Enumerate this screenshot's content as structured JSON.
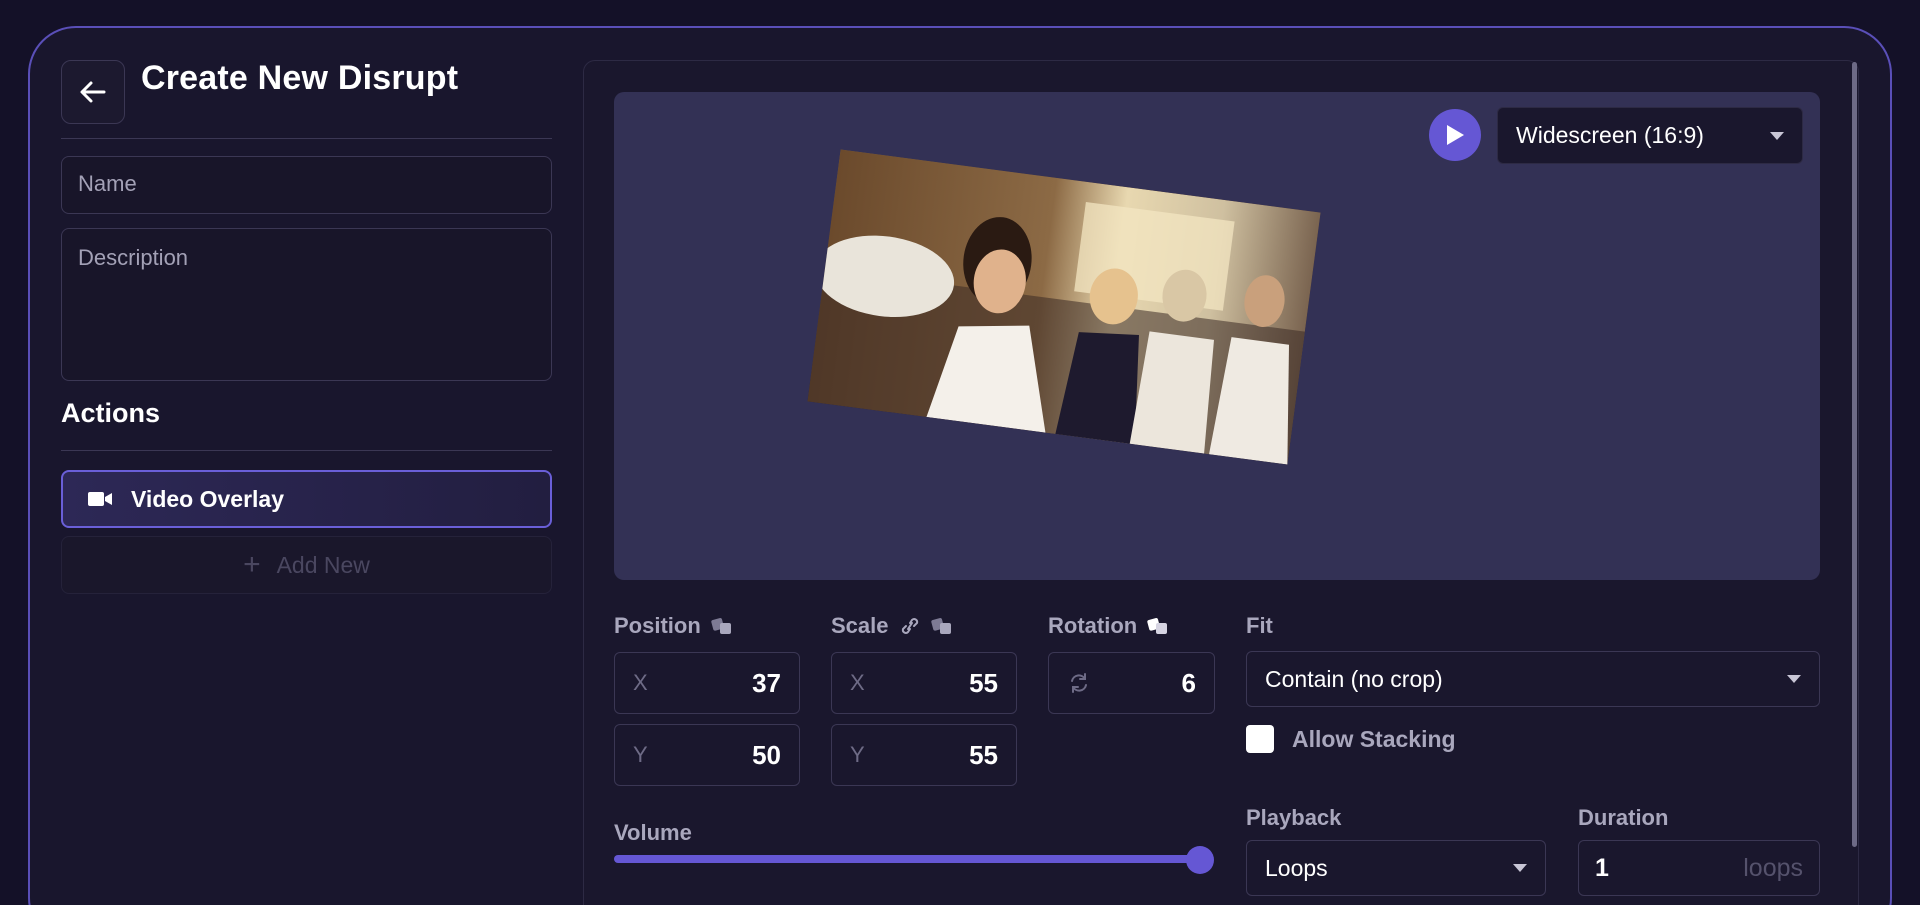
{
  "page": {
    "title": "Create New Disrupt"
  },
  "form": {
    "name_placeholder": "Name",
    "description_placeholder": "Description"
  },
  "actions": {
    "heading": "Actions",
    "items": [
      {
        "label": "Video Overlay",
        "icon": "video-camera-icon",
        "selected": true
      }
    ],
    "add_new_label": "Add New"
  },
  "preview": {
    "aspect_ratio": "Widescreen (16:9)",
    "play_icon": "play-icon"
  },
  "controls": {
    "position": {
      "label": "Position",
      "x_axis": "X",
      "y_axis": "Y",
      "x": "37",
      "y": "50"
    },
    "scale": {
      "label": "Scale",
      "x_axis": "X",
      "y_axis": "Y",
      "x": "55",
      "y": "55"
    },
    "rotation": {
      "label": "Rotation",
      "value": "6"
    },
    "fit": {
      "label": "Fit",
      "value": "Contain (no crop)"
    },
    "allow_stacking": {
      "label": "Allow Stacking",
      "checked": false
    },
    "volume": {
      "label": "Volume",
      "level": 1.0
    },
    "playback": {
      "label": "Playback",
      "value": "Loops"
    },
    "duration": {
      "label": "Duration",
      "value": "1",
      "unit": "loops"
    }
  },
  "colors": {
    "accent": "#6557d4",
    "background": "#141128",
    "panel": "#1a172d",
    "preview_bg": "#333155"
  }
}
